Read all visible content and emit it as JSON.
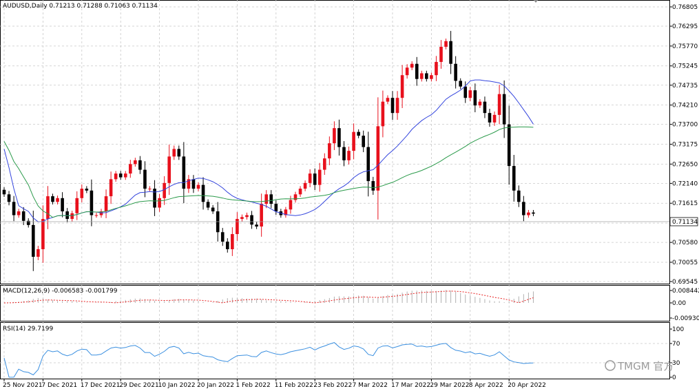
{
  "header": {
    "main": "AUDUSD,Daily  0.71213 0.71288 0.71063 0.71134",
    "macd": "MACD(12,26,9) -0.006583 -0.001799",
    "rsi": "RSI(14) 29.7199"
  },
  "watermark": "TMGM 官方",
  "colors": {
    "bull": "#e8101c",
    "bear": "#000000",
    "ma_fast": "#3344dd",
    "ma_slow": "#2a9a4a",
    "rsi": "#3a8fe0",
    "macd_signal": "#e82020",
    "macd_hist": "#b0b0b0",
    "grid": "#c8c8c8"
  },
  "chart_data": [
    {
      "type": "candlestick",
      "symbol": "AUDUSD",
      "timeframe": "Daily",
      "current_price": 0.71134,
      "current_price_label": "0.71134",
      "ylim": [
        0.69545,
        0.7685
      ],
      "yticks": [
        0.76805,
        0.76295,
        0.7577,
        0.75245,
        0.74735,
        0.7421,
        0.737,
        0.73175,
        0.7265,
        0.7214,
        0.71615,
        0.7109,
        0.7058,
        0.70055,
        0.69545
      ],
      "ytick_labels": [
        "0.76805",
        "0.76295",
        "0.75770",
        "0.75245",
        "0.74735",
        "0.74210",
        "0.73700",
        "0.73175",
        "0.72650",
        "0.72140",
        "0.71615",
        "0.71090",
        "0.70580",
        "0.70055",
        "0.69545"
      ],
      "xtick_labels": [
        {
          "label": "25 Nov 2021",
          "index": 0
        },
        {
          "label": "7 Dec 2021",
          "index": 8
        },
        {
          "label": "17 Dec 2021",
          "index": 16
        },
        {
          "label": "29 Dec 2021",
          "index": 24
        },
        {
          "label": "10 Jan 2022",
          "index": 32
        },
        {
          "label": "20 Jan 2022",
          "index": 40
        },
        {
          "label": "1 Feb 2022",
          "index": 48
        },
        {
          "label": "11 Feb 2022",
          "index": 56
        },
        {
          "label": "23 Feb 2022",
          "index": 64
        },
        {
          "label": "7 Mar 2022",
          "index": 72
        },
        {
          "label": "17 Mar 2022",
          "index": 80
        },
        {
          "label": "29 Mar 2022",
          "index": 88
        },
        {
          "label": "8 Apr 2022",
          "index": 96
        },
        {
          "label": "20 Apr 2022",
          "index": 104
        }
      ],
      "series_close": [
        0.7185,
        0.7165,
        0.713,
        0.714,
        0.7115,
        0.7104,
        0.702,
        0.704,
        0.712,
        0.718,
        0.7165,
        0.7175,
        0.714,
        0.712,
        0.7135,
        0.7175,
        0.72,
        0.7195,
        0.713,
        0.713,
        0.714,
        0.718,
        0.7225,
        0.724,
        0.723,
        0.724,
        0.7265,
        0.7275,
        0.725,
        0.72,
        0.72,
        0.715,
        0.7175,
        0.7215,
        0.7285,
        0.7305,
        0.7285,
        0.72,
        0.7225,
        0.72,
        0.721,
        0.7165,
        0.715,
        0.714,
        0.7085,
        0.706,
        0.704,
        0.708,
        0.712,
        0.7125,
        0.713,
        0.7105,
        0.71,
        0.716,
        0.7185,
        0.716,
        0.714,
        0.713,
        0.7145,
        0.717,
        0.7185,
        0.72,
        0.7215,
        0.724,
        0.721,
        0.725,
        0.728,
        0.732,
        0.736,
        0.731,
        0.7275,
        0.73,
        0.735,
        0.734,
        0.731,
        0.722,
        0.7195,
        0.7365,
        0.743,
        0.744,
        0.74,
        0.744,
        0.75,
        0.752,
        0.753,
        0.749,
        0.7505,
        0.749,
        0.75,
        0.7535,
        0.7575,
        0.759,
        0.753,
        0.7485,
        0.747,
        0.744,
        0.746,
        0.742,
        0.743,
        0.74,
        0.7375,
        0.7395,
        0.745,
        0.737,
        0.726,
        0.7195,
        0.7165,
        0.713,
        0.7137,
        0.7134
      ],
      "series": [
        {
          "name": "MA fast",
          "color": "#3344dd"
        },
        {
          "name": "MA slow",
          "color": "#2a9a4a"
        }
      ]
    },
    {
      "type": "bar",
      "name": "MACD(12,26,9)",
      "values_label": "-0.006583 -0.001799",
      "yticks_labels": [
        "0.008442",
        "0.00",
        "-0.009304"
      ],
      "ylim": [
        -0.0093,
        0.0085
      ]
    },
    {
      "type": "line",
      "name": "RSI(14)",
      "value": 29.7199,
      "yticks": [
        100,
        70,
        30,
        0
      ],
      "ylim": [
        0,
        100
      ]
    }
  ]
}
